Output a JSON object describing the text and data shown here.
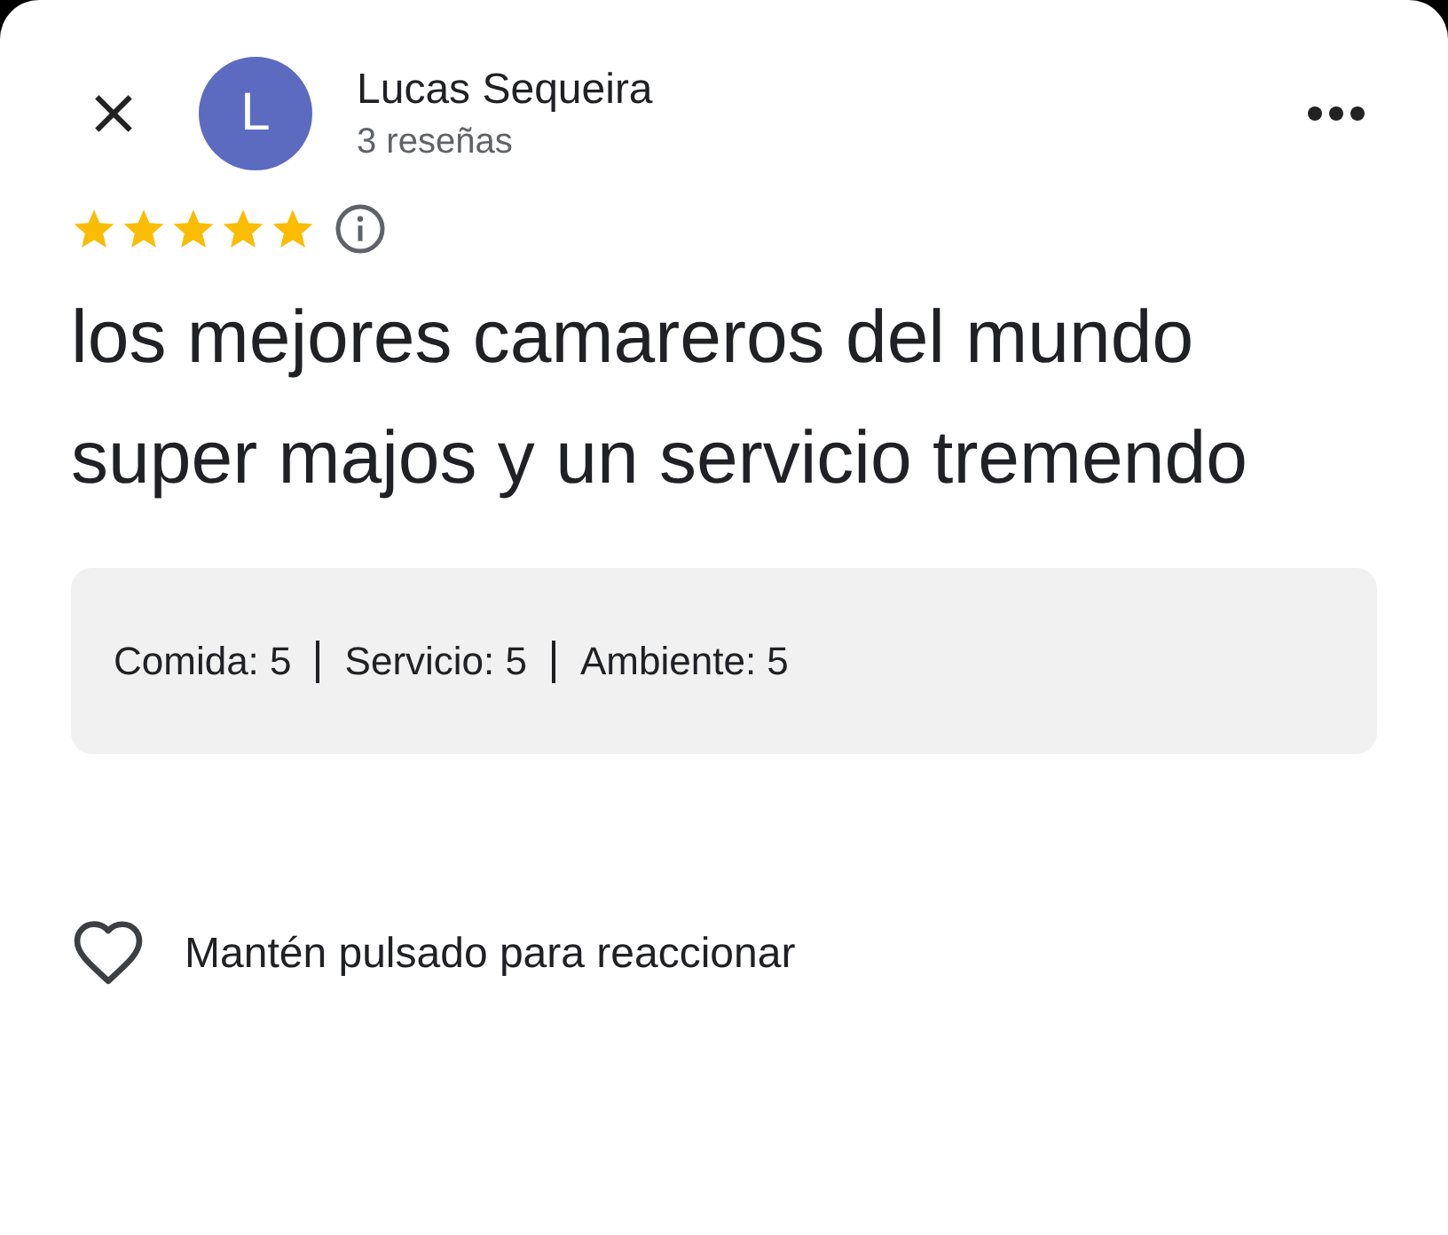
{
  "author": {
    "initial": "L",
    "name": "Lucas Sequeira",
    "reviews": "3 reseñas"
  },
  "rating": {
    "stars": 5
  },
  "review_text": "los mejores camareros del mundo super majos y un servicio tremendo",
  "aspects": [
    {
      "label": "Comida: 5"
    },
    {
      "label": "Servicio: 5"
    },
    {
      "label": "Ambiente: 5"
    }
  ],
  "reaction_hint": "Mantén pulsado para reaccionar"
}
